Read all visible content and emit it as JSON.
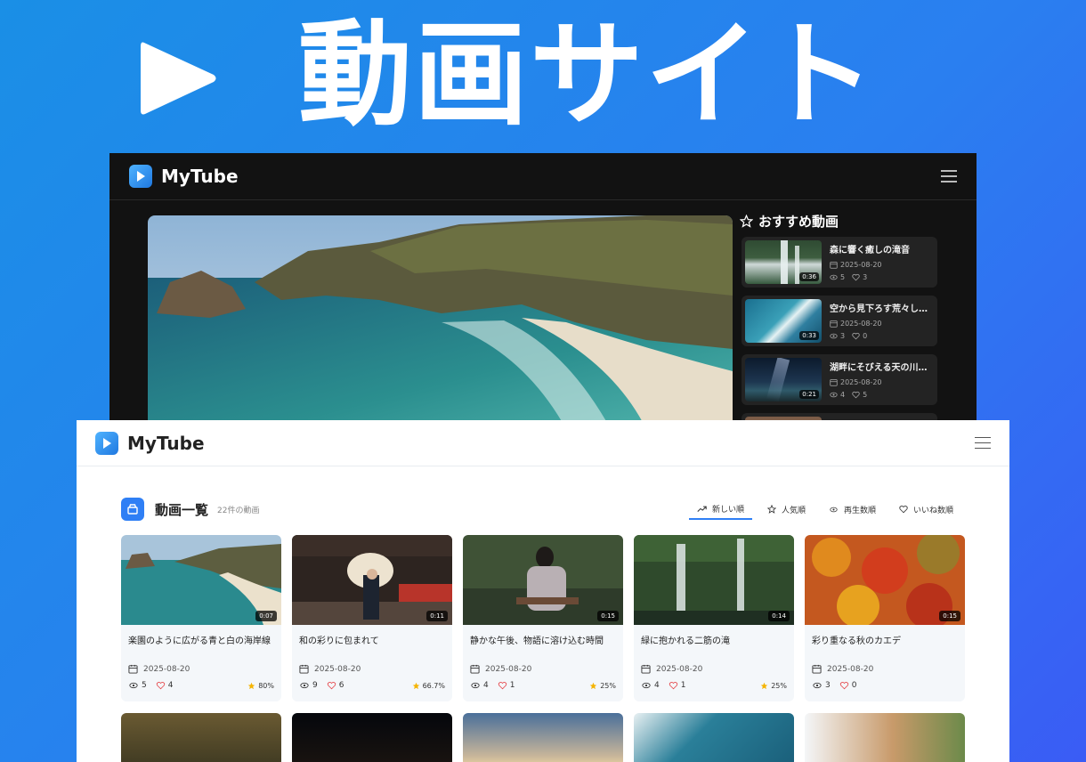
{
  "hero": {
    "title": "動画サイト"
  },
  "dark": {
    "logo": "MyTube",
    "recommended_title": "おすすめ動画",
    "items": [
      {
        "title": "森に響く癒しの滝音",
        "date": "2025-08-20",
        "views": "5",
        "likes": "3",
        "duration": "0:36",
        "thumb": "waterfall"
      },
      {
        "title": "空から見下ろす荒々しい…",
        "date": "2025-08-20",
        "views": "3",
        "likes": "0",
        "duration": "0:33",
        "thumb": "ocean"
      },
      {
        "title": "湖畔にそびえる天の川の…",
        "date": "2025-08-20",
        "views": "4",
        "likes": "5",
        "duration": "0:21",
        "thumb": "night"
      }
    ]
  },
  "light": {
    "logo": "MyTube",
    "list_title": "動画一覧",
    "list_count": "22件の動画",
    "sorts": [
      {
        "label": "新しい順",
        "icon": "trending-icon",
        "active": true
      },
      {
        "label": "人気順",
        "icon": "star-icon",
        "active": false
      },
      {
        "label": "再生数順",
        "icon": "eye-icon",
        "active": false
      },
      {
        "label": "いいね数順",
        "icon": "heart-icon",
        "active": false
      }
    ],
    "videos": [
      {
        "title": "楽園のように広がる青と白の海岸線",
        "date": "2025-08-20",
        "views": "5",
        "likes": "4",
        "rating": "80%",
        "duration": "0:07",
        "thumb": "beach"
      },
      {
        "title": "和の彩りに包まれて",
        "date": "2025-08-20",
        "views": "9",
        "likes": "6",
        "rating": "66.7%",
        "duration": "0:11",
        "thumb": "kimono"
      },
      {
        "title": "静かな午後、物語に溶け込む時間",
        "date": "2025-08-20",
        "views": "4",
        "likes": "1",
        "rating": "25%",
        "duration": "0:15",
        "thumb": "reading"
      },
      {
        "title": "緑に抱かれる二筋の滝",
        "date": "2025-08-20",
        "views": "4",
        "likes": "1",
        "rating": "25%",
        "duration": "0:14",
        "thumb": "twin-falls"
      },
      {
        "title": "彩り重なる秋のカエデ",
        "date": "2025-08-20",
        "views": "3",
        "likes": "0",
        "rating": "",
        "duration": "0:15",
        "thumb": "maple"
      }
    ],
    "peek_thumbs": [
      "forest",
      "city-night",
      "sunset",
      "ocean2",
      "giraffe"
    ]
  },
  "colors": {
    "accent": "#2f7ff5",
    "heart": "#e5484d",
    "star": "#f5b400"
  }
}
